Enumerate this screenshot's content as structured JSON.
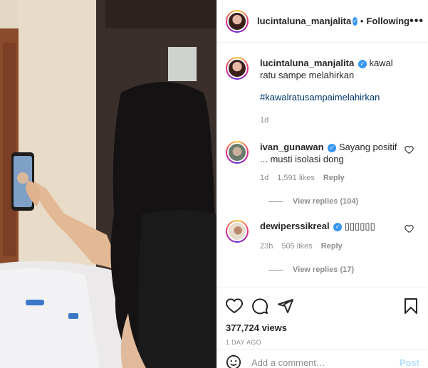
{
  "post": {
    "author": "lucintaluna_manjalita",
    "follow_status": "Following",
    "more_label": "•••",
    "caption_text": "kawal ratu sampe melahirkan",
    "hashtag": "#kawalratusampaimelahirkan",
    "caption_time": "1d"
  },
  "comments": [
    {
      "user": "ivan_gunawan",
      "text": "Sayang positif ... musti isolasi dong",
      "time": "1d",
      "likes": "1,591 likes",
      "reply": "Reply",
      "view_replies": "View replies (104)"
    },
    {
      "user": "dewiperssikreal",
      "text": "▯▯▯▯▯▯",
      "time": "23h",
      "likes": "505 likes",
      "reply": "Reply",
      "view_replies": "View replies (17)"
    }
  ],
  "stats": {
    "views": "377,724 views",
    "time_ago": "1 DAY AGO"
  },
  "add_comment": {
    "placeholder": "Add a comment…",
    "post_label": "Post"
  },
  "icons": [
    "heart-icon",
    "comment-icon",
    "share-icon",
    "bookmark-icon",
    "emoji-icon",
    "more-icon",
    "verified-icon"
  ]
}
